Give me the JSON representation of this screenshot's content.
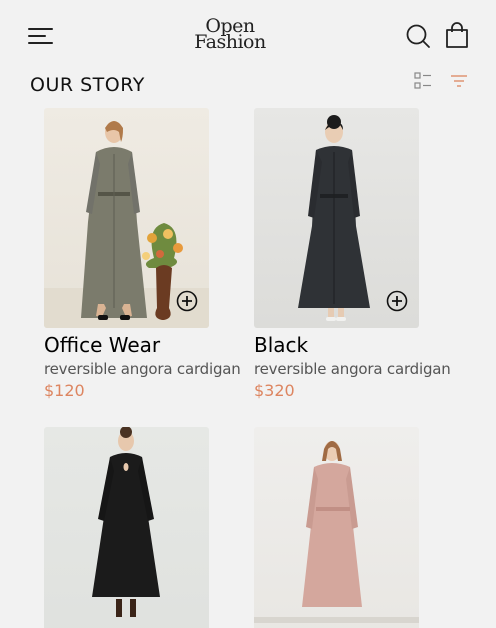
{
  "header": {
    "logo_line1": "Open",
    "logo_line2": "Fashion",
    "menu_icon": "hamburger-menu-icon",
    "search_icon": "search-icon",
    "bag_icon": "shopping-bag-icon"
  },
  "section": {
    "title": "OUR STORY",
    "grid_view_icon": "grid-view-icon",
    "filter_icon": "filter-icon"
  },
  "colors": {
    "background": "#f2f2f2",
    "price": "#dd8560",
    "accent": "#dd8560"
  },
  "products": [
    {
      "name": "Office Wear",
      "description": "reversible angora cardigan",
      "price": "$120"
    },
    {
      "name": "Black",
      "description": "reversible angora cardigan",
      "price": "$320"
    },
    {
      "name": "",
      "description": "",
      "price": ""
    },
    {
      "name": "",
      "description": "",
      "price": ""
    }
  ]
}
